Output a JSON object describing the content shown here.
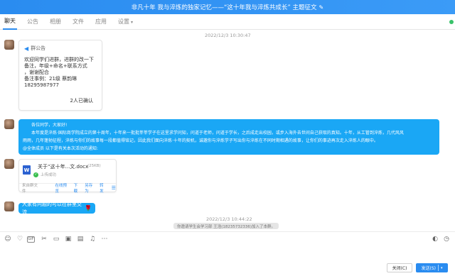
{
  "title": {
    "text": "非凡十年 我与淬炼的独家记忆——“这十年我与淬炼共成长” 主题征文",
    "edit_icon": "edit-icon"
  },
  "tabs": [
    {
      "label": "聊天",
      "active": true
    },
    {
      "label": "公告"
    },
    {
      "label": "相册"
    },
    {
      "label": "文件"
    },
    {
      "label": "应用"
    },
    {
      "label": "设置"
    }
  ],
  "chat": {
    "timestamp1": "2022/12/3 10:30:47",
    "notice": {
      "header": "群公告",
      "lines": [
        "欢迎同学们进群，进群的改一下",
        "备注，年级+命名+联系方式",
        "，谢谢配合",
        "备注事例：21级 蔡韵琳",
        "18295987977"
      ],
      "confirm": "2人已确认"
    },
    "big_message": {
      "lines": [
        "各位同学，大家好!",
        "本年度是淬炼·国际商学院成立的第十周年，十年来一批批莘莘学子在这里求学问知，问道于老师，问道于学长，之后成走出校园，或步入海外去世间自己获取的真知。十年，从工管到淬炼，几代风风",
        "雨雨，几年蓬勃征程，淬炼与你们的故事每一段都值得铭记，因此我们面向淬炼·十年的契机，诚邀你与淬炼学子写出你与淬炼在不同时期相遇的故事，让你们的事迹再次走入淬炼人的眼中。",
        "@全体成员 以下是有关本次活动的通知:"
      ]
    },
    "file": {
      "icon_letter": "W",
      "name": "关于“这十年...文.docx",
      "size": "(25KB)",
      "status": "上传成功",
      "source": "来自群文件",
      "actions": [
        "在线预览",
        "下载",
        "另存为",
        "转发"
      ]
    },
    "short_message": "大家有问题的可以在群里交流",
    "timestamp2": "2022/12/3 10:44:22",
    "system_message": "你邀请学生会学习部 王浩(18235732336)加入了本群。"
  },
  "buttons": {
    "close": "关闭(C)",
    "send": "发送(S)"
  },
  "colors": {
    "accent": "#2a8cf0",
    "bubble": "#1aa7f5"
  }
}
